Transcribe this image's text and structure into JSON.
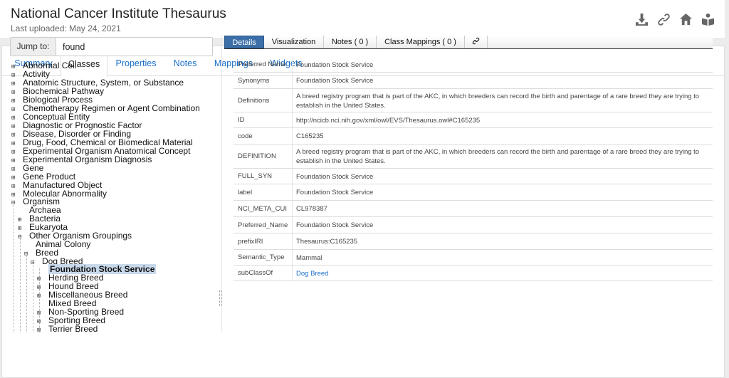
{
  "header": {
    "title": "National Cancer Institute Thesaurus",
    "subtitle": "Last uploaded: May 24, 2021",
    "icons": [
      "download-icon",
      "link-icon",
      "home-icon",
      "book-icon"
    ]
  },
  "tabs": [
    "Summary",
    "Classes",
    "Properties",
    "Notes",
    "Mappings",
    "Widgets"
  ],
  "active_tab": "Classes",
  "jump": {
    "label": "Jump to:",
    "value": "found"
  },
  "tree": [
    {
      "label": "Abnormal Cell",
      "toggle": "⊞"
    },
    {
      "label": "Activity",
      "toggle": "⊞"
    },
    {
      "label": "Anatomic Structure, System, or Substance",
      "toggle": "⊞"
    },
    {
      "label": "Biochemical Pathway",
      "toggle": "⊞"
    },
    {
      "label": "Biological Process",
      "toggle": "⊞"
    },
    {
      "label": "Chemotherapy Regimen or Agent Combination",
      "toggle": "⊞"
    },
    {
      "label": "Conceptual Entity",
      "toggle": "⊞"
    },
    {
      "label": "Diagnostic or Prognostic Factor",
      "toggle": "⊞"
    },
    {
      "label": "Disease, Disorder or Finding",
      "toggle": "⊞"
    },
    {
      "label": "Drug, Food, Chemical or Biomedical Material",
      "toggle": "⊞"
    },
    {
      "label": "Experimental Organism Anatomical Concept",
      "toggle": "⊞"
    },
    {
      "label": "Experimental Organism Diagnosis",
      "toggle": "⊞"
    },
    {
      "label": "Gene",
      "toggle": "⊞"
    },
    {
      "label": "Gene Product",
      "toggle": "⊞"
    },
    {
      "label": "Manufactured Object",
      "toggle": "⊞"
    },
    {
      "label": "Molecular Abnormality",
      "toggle": "⊞"
    },
    {
      "label": "Organism",
      "toggle": "⊟"
    },
    {
      "label": "Archaea",
      "toggle": ""
    },
    {
      "label": "Bacteria",
      "toggle": "⊞"
    },
    {
      "label": "Eukaryota",
      "toggle": "⊞"
    },
    {
      "label": "Other Organism Groupings",
      "toggle": "⊟"
    },
    {
      "label": "Animal Colony",
      "toggle": ""
    },
    {
      "label": "Breed",
      "toggle": "⊟"
    },
    {
      "label": "Dog Breed",
      "toggle": "⊟"
    },
    {
      "label": "Foundation Stock Service",
      "toggle": ""
    },
    {
      "label": "Herding Breed",
      "toggle": "⊞"
    },
    {
      "label": "Hound Breed",
      "toggle": "⊞"
    },
    {
      "label": "Miscellaneous Breed",
      "toggle": "⊞"
    },
    {
      "label": "Mixed Breed",
      "toggle": ""
    },
    {
      "label": "Non-Sporting Breed",
      "toggle": "⊞"
    },
    {
      "label": "Sporting Breed",
      "toggle": "⊞"
    },
    {
      "label": "Terrier Breed",
      "toggle": "⊞"
    }
  ],
  "selected": "Foundation Stock Service",
  "detail_tabs": [
    "Details",
    "Visualization",
    "Notes ( 0 )",
    "Class Mappings ( 0 )"
  ],
  "detail_link_icon": "link-icon",
  "details": [
    {
      "key": "Preferred Name",
      "value": "Foundation Stock Service"
    },
    {
      "key": "Synonyms",
      "value": "Foundation Stock Service"
    },
    {
      "key": "Definitions",
      "value": "A breed registry program that is part of the AKC, in which breeders can record the birth and parentage of a rare breed they are trying to establish in the United States."
    },
    {
      "key": "ID",
      "value": "http://ncicb.nci.nih.gov/xml/owl/EVS/Thesaurus.owl#C165235"
    },
    {
      "key": "code",
      "value": "C165235"
    },
    {
      "key": "DEFINITION",
      "value": "A breed registry program that is part of the AKC, in which breeders can record the birth and parentage of a rare breed they are trying to establish in the United States."
    },
    {
      "key": "FULL_SYN",
      "value": "Foundation Stock Service"
    },
    {
      "key": "label",
      "value": "Foundation Stock Service"
    },
    {
      "key": "NCI_META_CUI",
      "value": "CL978387"
    },
    {
      "key": "Preferred_Name",
      "value": "Foundation Stock Service"
    },
    {
      "key": "prefixIRI",
      "value": "Thesaurus:C165235"
    },
    {
      "key": "Semantic_Type",
      "value": "Mammal"
    },
    {
      "key": "subClassOf",
      "value": "Dog Breed"
    }
  ]
}
